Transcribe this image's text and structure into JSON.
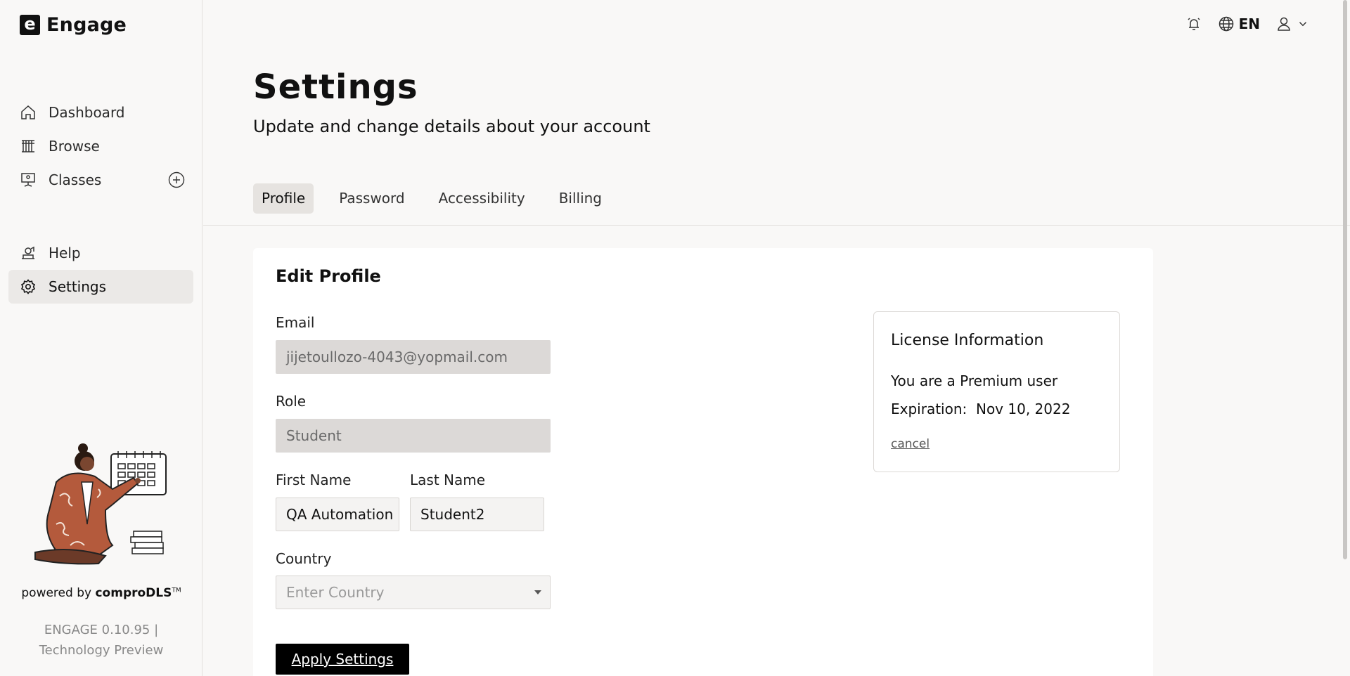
{
  "app": {
    "logo_letter": "e",
    "name": "Engage"
  },
  "sidebar": {
    "items": [
      {
        "label": "Dashboard",
        "icon": "home-icon"
      },
      {
        "label": "Browse",
        "icon": "library-icon"
      },
      {
        "label": "Classes",
        "icon": "presentation-icon"
      },
      {
        "label": "Help",
        "icon": "help-desk-icon"
      },
      {
        "label": "Settings",
        "icon": "gear-icon"
      }
    ],
    "active": "Settings",
    "powered_prefix": "powered by ",
    "powered_brand": "comproDLS",
    "powered_tm": "TM",
    "version_line1": "ENGAGE 0.10.95 |",
    "version_line2": "Technology Preview"
  },
  "topbar": {
    "language": "EN",
    "icons": [
      "alarm-icon",
      "globe-icon",
      "user-icon",
      "chevron-down-icon"
    ]
  },
  "header": {
    "title": "Settings",
    "subtitle": "Update and change details about your account"
  },
  "tabs": [
    {
      "label": "Profile",
      "active": true
    },
    {
      "label": "Password",
      "active": false
    },
    {
      "label": "Accessibility",
      "active": false
    },
    {
      "label": "Billing",
      "active": false
    }
  ],
  "profile": {
    "title": "Edit Profile",
    "email_label": "Email",
    "email_value": "jijetoullozo-4043@yopmail.com",
    "role_label": "Role",
    "role_value": "Student",
    "first_name_label": "First Name",
    "first_name_value": "QA Automation",
    "last_name_label": "Last Name",
    "last_name_value": "Student2",
    "country_label": "Country",
    "country_placeholder": "Enter Country",
    "apply_label": "Apply Settings"
  },
  "license": {
    "title": "License Information",
    "user_text": "You are a Premium user",
    "expiration_label": "Expiration:",
    "expiration_value": "Nov 10, 2022",
    "cancel_label": "cancel"
  },
  "colors": {
    "accent_dark": "#000000",
    "illustration": "#b45a3c",
    "background": "#f9f8f7"
  }
}
